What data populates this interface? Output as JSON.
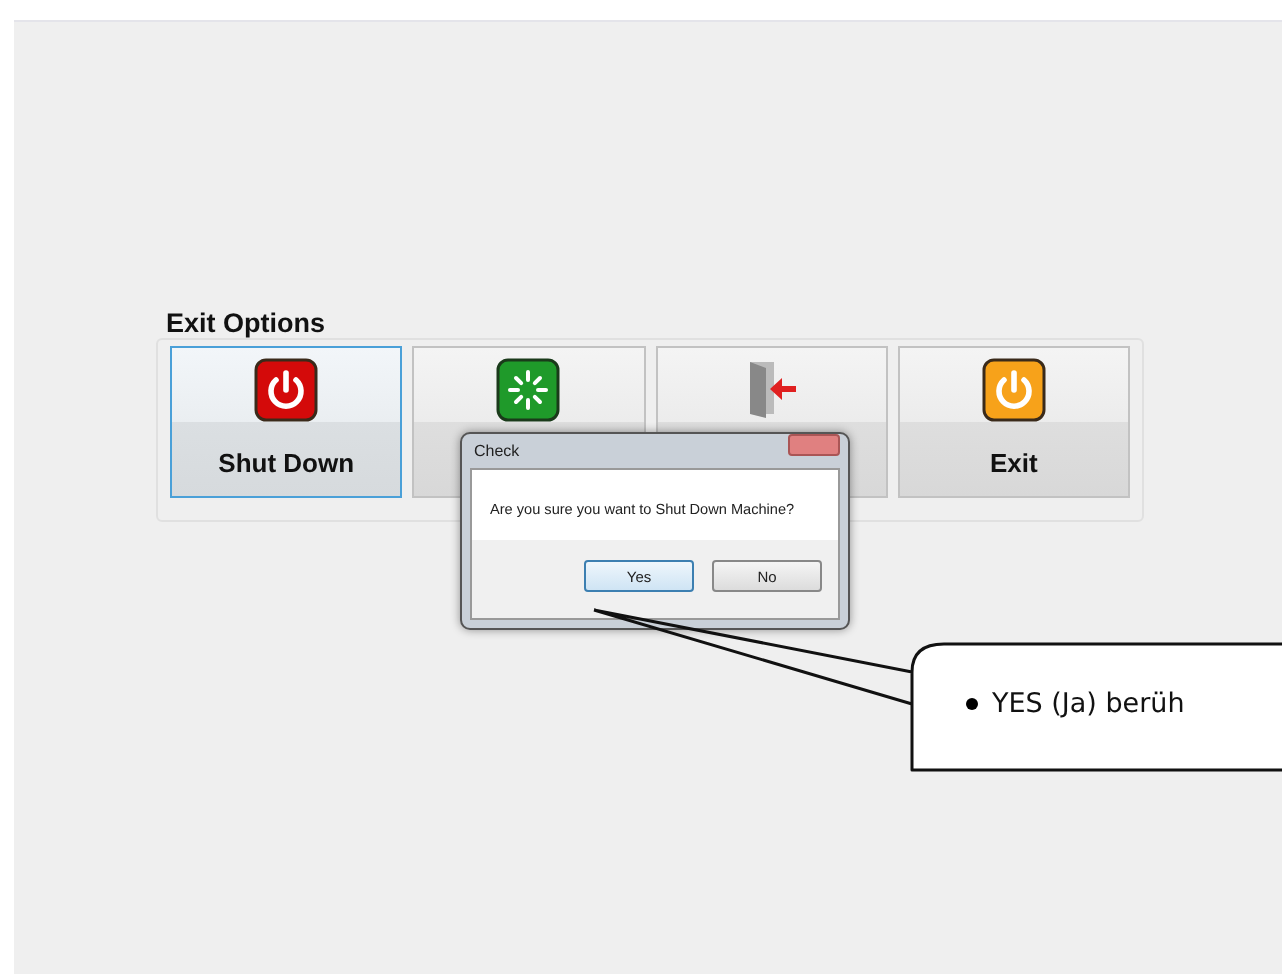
{
  "options_group": {
    "title": "Exit Options",
    "buttons": [
      {
        "label": "Shut Down",
        "kind": "shutdown",
        "selected": true
      },
      {
        "kind": "restart",
        "selected": false
      },
      {
        "kind": "logoff",
        "selected": false
      },
      {
        "label": "Exit",
        "kind": "exit",
        "selected": false
      }
    ]
  },
  "dialog": {
    "title": "Check",
    "message": "Are you sure you want to Shut Down Machine?",
    "buttons": [
      {
        "label": "Yes",
        "selected": true
      },
      {
        "label": "No",
        "selected": false
      }
    ]
  },
  "callout": {
    "items": [
      "YES (Ja) berüh"
    ]
  }
}
